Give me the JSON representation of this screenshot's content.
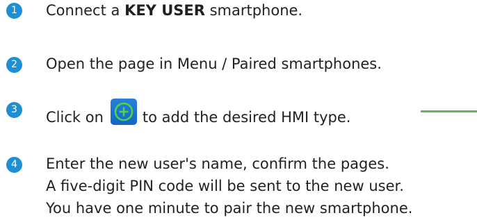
{
  "steps": [
    {
      "number": "1",
      "prefix": "Connect a ",
      "emphasis": "KEY USER",
      "suffix": " smartphone."
    },
    {
      "number": "2",
      "text": "Open the page in Menu / Paired smartphones."
    },
    {
      "number": "3",
      "prefix": "Click on",
      "suffix": "to add the desired HMI type.",
      "icon": "add-circle-icon"
    },
    {
      "number": "4",
      "lines": [
        "Enter the new user's name, confirm the pages.",
        "A five-digit PIN code will be sent to the new user.",
        "You have one minute to pair the new smartphone."
      ]
    }
  ],
  "colors": {
    "badge": "#1e8fd0",
    "icon_background": "#1a73d1",
    "icon_symbol": "#4cd64c",
    "connector": "#5cb85c"
  }
}
